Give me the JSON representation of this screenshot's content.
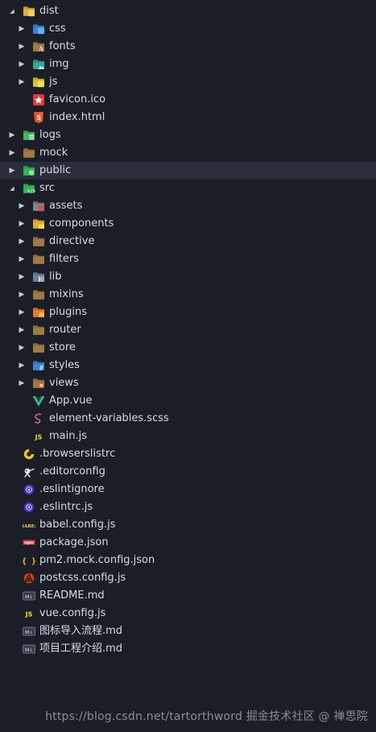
{
  "tree": [
    {
      "label": "dist",
      "level": 0,
      "chevron": "down",
      "icon": "folder-dist-icon",
      "selected": false
    },
    {
      "label": "css",
      "level": 1,
      "chevron": "right",
      "icon": "folder-css-icon",
      "selected": false
    },
    {
      "label": "fonts",
      "level": 1,
      "chevron": "right",
      "icon": "folder-fonts-icon",
      "selected": false
    },
    {
      "label": "img",
      "level": 1,
      "chevron": "right",
      "icon": "folder-images-icon",
      "selected": false
    },
    {
      "label": "js",
      "level": 1,
      "chevron": "right",
      "icon": "folder-js-icon",
      "selected": false
    },
    {
      "label": "favicon.ico",
      "level": 1,
      "chevron": "none",
      "icon": "favicon-file-icon",
      "selected": false
    },
    {
      "label": "index.html",
      "level": 1,
      "chevron": "none",
      "icon": "html5-file-icon",
      "selected": false
    },
    {
      "label": "logs",
      "level": 0,
      "chevron": "right",
      "icon": "folder-logs-icon",
      "selected": false
    },
    {
      "label": "mock",
      "level": 0,
      "chevron": "right",
      "icon": "folder-icon",
      "selected": false
    },
    {
      "label": "public",
      "level": 0,
      "chevron": "right",
      "icon": "folder-public-icon",
      "selected": true
    },
    {
      "label": "src",
      "level": 0,
      "chevron": "down",
      "icon": "folder-src-icon",
      "selected": false
    },
    {
      "label": "assets",
      "level": 1,
      "chevron": "right",
      "icon": "folder-assets-icon",
      "selected": false
    },
    {
      "label": "components",
      "level": 1,
      "chevron": "right",
      "icon": "folder-components-icon",
      "selected": false
    },
    {
      "label": "directive",
      "level": 1,
      "chevron": "right",
      "icon": "folder-icon",
      "selected": false
    },
    {
      "label": "filters",
      "level": 1,
      "chevron": "right",
      "icon": "folder-icon",
      "selected": false
    },
    {
      "label": "lib",
      "level": 1,
      "chevron": "right",
      "icon": "folder-lib-icon",
      "selected": false
    },
    {
      "label": "mixins",
      "level": 1,
      "chevron": "right",
      "icon": "folder-icon",
      "selected": false
    },
    {
      "label": "plugins",
      "level": 1,
      "chevron": "right",
      "icon": "folder-plugins-icon",
      "selected": false
    },
    {
      "label": "router",
      "level": 1,
      "chevron": "right",
      "icon": "folder-icon",
      "selected": false
    },
    {
      "label": "store",
      "level": 1,
      "chevron": "right",
      "icon": "folder-icon",
      "selected": false
    },
    {
      "label": "styles",
      "level": 1,
      "chevron": "right",
      "icon": "folder-styles-icon",
      "selected": false
    },
    {
      "label": "views",
      "level": 1,
      "chevron": "right",
      "icon": "folder-views-icon",
      "selected": false
    },
    {
      "label": "App.vue",
      "level": 1,
      "chevron": "none",
      "icon": "vue-file-icon",
      "selected": false
    },
    {
      "label": "element-variables.scss",
      "level": 1,
      "chevron": "none",
      "icon": "sass-file-icon",
      "selected": false
    },
    {
      "label": "main.js",
      "level": 1,
      "chevron": "none",
      "icon": "js-file-icon",
      "selected": false
    },
    {
      "label": ".browserslistrc",
      "level": 0,
      "chevron": "none",
      "icon": "browserslist-file-icon",
      "selected": false
    },
    {
      "label": ".editorconfig",
      "level": 0,
      "chevron": "none",
      "icon": "editorconfig-file-icon",
      "selected": false
    },
    {
      "label": ".eslintignore",
      "level": 0,
      "chevron": "none",
      "icon": "eslint-file-icon",
      "selected": false
    },
    {
      "label": ".eslintrc.js",
      "level": 0,
      "chevron": "none",
      "icon": "eslint-file-icon",
      "selected": false
    },
    {
      "label": "babel.config.js",
      "level": 0,
      "chevron": "none",
      "icon": "babel-file-icon",
      "selected": false
    },
    {
      "label": "package.json",
      "level": 0,
      "chevron": "none",
      "icon": "npm-file-icon",
      "selected": false
    },
    {
      "label": "pm2.mock.config.json",
      "level": 0,
      "chevron": "none",
      "icon": "json-file-icon",
      "selected": false
    },
    {
      "label": "postcss.config.js",
      "level": 0,
      "chevron": "none",
      "icon": "postcss-file-icon",
      "selected": false
    },
    {
      "label": "README.md",
      "level": 0,
      "chevron": "none",
      "icon": "markdown-file-icon",
      "selected": false
    },
    {
      "label": "vue.config.js",
      "level": 0,
      "chevron": "none",
      "icon": "js-file-icon",
      "selected": false
    },
    {
      "label": "图标导入流程.md",
      "level": 0,
      "chevron": "none",
      "icon": "markdown-file-icon",
      "selected": false
    },
    {
      "label": "项目工程介绍.md",
      "level": 0,
      "chevron": "none",
      "icon": "markdown-file-icon",
      "selected": false
    }
  ],
  "watermark": "https://blog.csdn.net/tartorthword   掘金技术社区 @ 禅思院",
  "colors": {
    "background": "#1b1e27",
    "selected_row": "#2a2e39",
    "text": "#d6dce6"
  }
}
